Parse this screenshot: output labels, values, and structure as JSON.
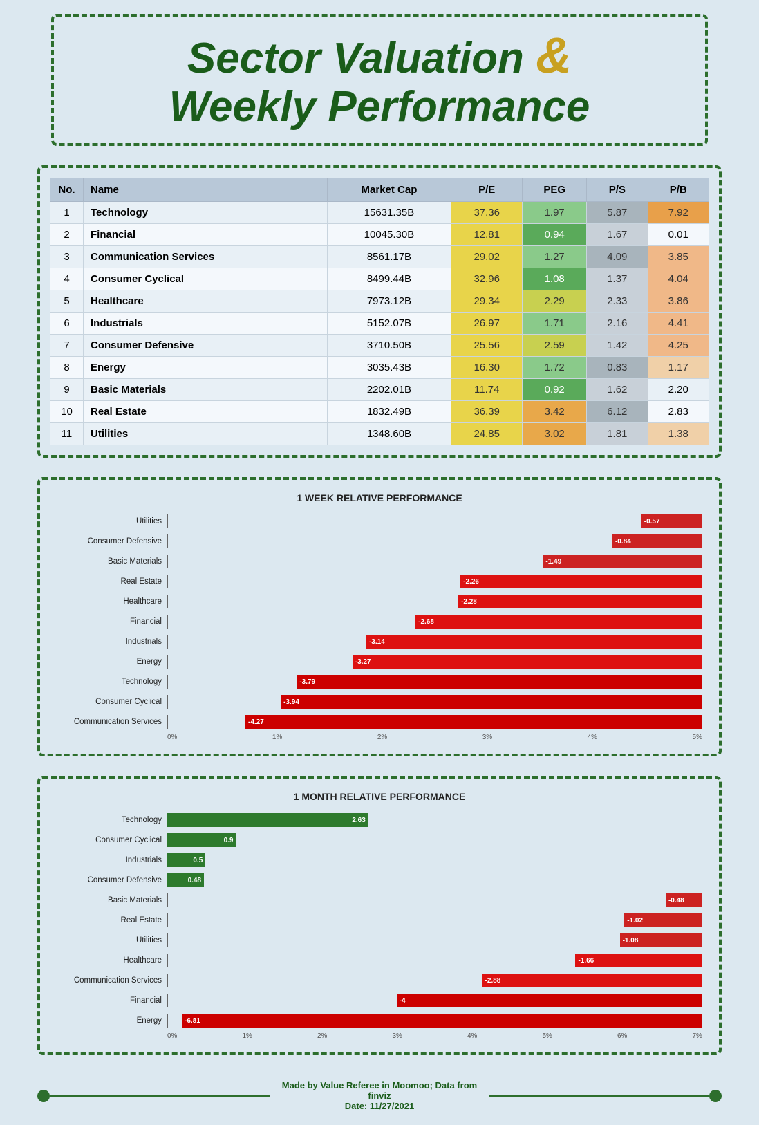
{
  "title": {
    "line1": "Sector Valuation",
    "amp": "&",
    "line2": "Weekly Performance"
  },
  "table": {
    "headers": [
      "No.",
      "Name",
      "Market Cap",
      "P/E",
      "PEG",
      "P/S",
      "P/B"
    ],
    "rows": [
      {
        "no": 1,
        "name": "Technology",
        "marketcap": "15631.35B",
        "pe": "37.36",
        "peg": "1.97",
        "ps": "5.87",
        "pb": "7.92",
        "pe_class": "pe-yellow",
        "peg_class": "peg-green-light",
        "ps_class": "ps-gray",
        "pb_class": "pb-orange"
      },
      {
        "no": 2,
        "name": "Financial",
        "marketcap": "10045.30B",
        "pe": "12.81",
        "peg": "0.94",
        "ps": "1.67",
        "pb": "0.01",
        "pe_class": "pe-yellow",
        "peg_class": "peg-green-dark",
        "ps_class": "ps-lgray",
        "pb_class": ""
      },
      {
        "no": 3,
        "name": "Communication Services",
        "marketcap": "8561.17B",
        "pe": "29.02",
        "peg": "1.27",
        "ps": "4.09",
        "pb": "3.85",
        "pe_class": "pe-yellow",
        "peg_class": "peg-green-light",
        "ps_class": "ps-gray",
        "pb_class": "pb-peach"
      },
      {
        "no": 4,
        "name": "Consumer Cyclical",
        "marketcap": "8499.44B",
        "pe": "32.96",
        "peg": "1.08",
        "ps": "1.37",
        "pb": "4.04",
        "pe_class": "pe-yellow",
        "peg_class": "peg-green-dark",
        "ps_class": "ps-lgray",
        "pb_class": "pb-peach"
      },
      {
        "no": 5,
        "name": "Healthcare",
        "marketcap": "7973.12B",
        "pe": "29.34",
        "peg": "2.29",
        "ps": "2.33",
        "pb": "3.86",
        "pe_class": "pe-yellow",
        "peg_class": "peg-yellow",
        "ps_class": "ps-lgray",
        "pb_class": "pb-peach"
      },
      {
        "no": 6,
        "name": "Industrials",
        "marketcap": "5152.07B",
        "pe": "26.97",
        "peg": "1.71",
        "ps": "2.16",
        "pb": "4.41",
        "pe_class": "pe-yellow",
        "peg_class": "peg-green-light",
        "ps_class": "ps-lgray",
        "pb_class": "pb-peach"
      },
      {
        "no": 7,
        "name": "Consumer Defensive",
        "marketcap": "3710.50B",
        "pe": "25.56",
        "peg": "2.59",
        "ps": "1.42",
        "pb": "4.25",
        "pe_class": "pe-yellow",
        "peg_class": "peg-yellow",
        "ps_class": "ps-lgray",
        "pb_class": "pb-peach"
      },
      {
        "no": 8,
        "name": "Energy",
        "marketcap": "3035.43B",
        "pe": "16.30",
        "peg": "1.72",
        "ps": "0.83",
        "pb": "1.17",
        "pe_class": "pe-yellow",
        "peg_class": "peg-green-light",
        "ps_class": "ps-gray",
        "pb_class": "pb-light"
      },
      {
        "no": 9,
        "name": "Basic Materials",
        "marketcap": "2202.01B",
        "pe": "11.74",
        "peg": "0.92",
        "ps": "1.62",
        "pb": "2.20",
        "pe_class": "pe-yellow",
        "peg_class": "peg-green-dark",
        "ps_class": "ps-lgray",
        "pb_class": ""
      },
      {
        "no": 10,
        "name": "Real Estate",
        "marketcap": "1832.49B",
        "pe": "36.39",
        "peg": "3.42",
        "ps": "6.12",
        "pb": "2.83",
        "pe_class": "pe-yellow",
        "peg_class": "peg-orange",
        "ps_class": "ps-gray",
        "pb_class": ""
      },
      {
        "no": 11,
        "name": "Utilities",
        "marketcap": "1348.60B",
        "pe": "24.85",
        "peg": "3.02",
        "ps": "1.81",
        "pb": "1.38",
        "pe_class": "pe-yellow",
        "peg_class": "peg-orange",
        "ps_class": "ps-lgray",
        "pb_class": "pb-light"
      }
    ]
  },
  "chart1": {
    "title": "1 WEEK RELATIVE PERFORMANCE",
    "bars": [
      {
        "label": "Utilities",
        "value": -0.57
      },
      {
        "label": "Consumer Defensive",
        "value": -0.84
      },
      {
        "label": "Basic Materials",
        "value": -1.49
      },
      {
        "label": "Real Estate",
        "value": -2.26
      },
      {
        "label": "Healthcare",
        "value": -2.28
      },
      {
        "label": "Financial",
        "value": -2.68
      },
      {
        "label": "Industrials",
        "value": -3.14
      },
      {
        "label": "Energy",
        "value": -3.27
      },
      {
        "label": "Technology",
        "value": -3.79
      },
      {
        "label": "Consumer Cyclical",
        "value": -3.94
      },
      {
        "label": "Communication Services",
        "value": -4.27
      }
    ],
    "x_axis": [
      "0%",
      "1%",
      "2%",
      "3%",
      "4%",
      "5%"
    ],
    "max": 5
  },
  "chart2": {
    "title": "1 MONTH RELATIVE PERFORMANCE",
    "bars": [
      {
        "label": "Technology",
        "value": 2.63
      },
      {
        "label": "Consumer Cyclical",
        "value": 0.9
      },
      {
        "label": "Industrials",
        "value": 0.5
      },
      {
        "label": "Consumer Defensive",
        "value": 0.48
      },
      {
        "label": "Basic Materials",
        "value": -0.48
      },
      {
        "label": "Real Estate",
        "value": -1.02
      },
      {
        "label": "Utilities",
        "value": -1.08
      },
      {
        "label": "Healthcare",
        "value": -1.66
      },
      {
        "label": "Communication Services",
        "value": -2.88
      },
      {
        "label": "Financial",
        "value": -4.0
      },
      {
        "label": "Energy",
        "value": -6.81
      }
    ],
    "x_axis": [
      "0%",
      "1%",
      "2%",
      "3%",
      "4%",
      "5%",
      "6%",
      "7%"
    ],
    "max": 7
  },
  "footer": {
    "made_by": "Made by Value Referee in Moomoo; Data from finviz",
    "date_label": "Date:",
    "date": "11/27/2021"
  }
}
